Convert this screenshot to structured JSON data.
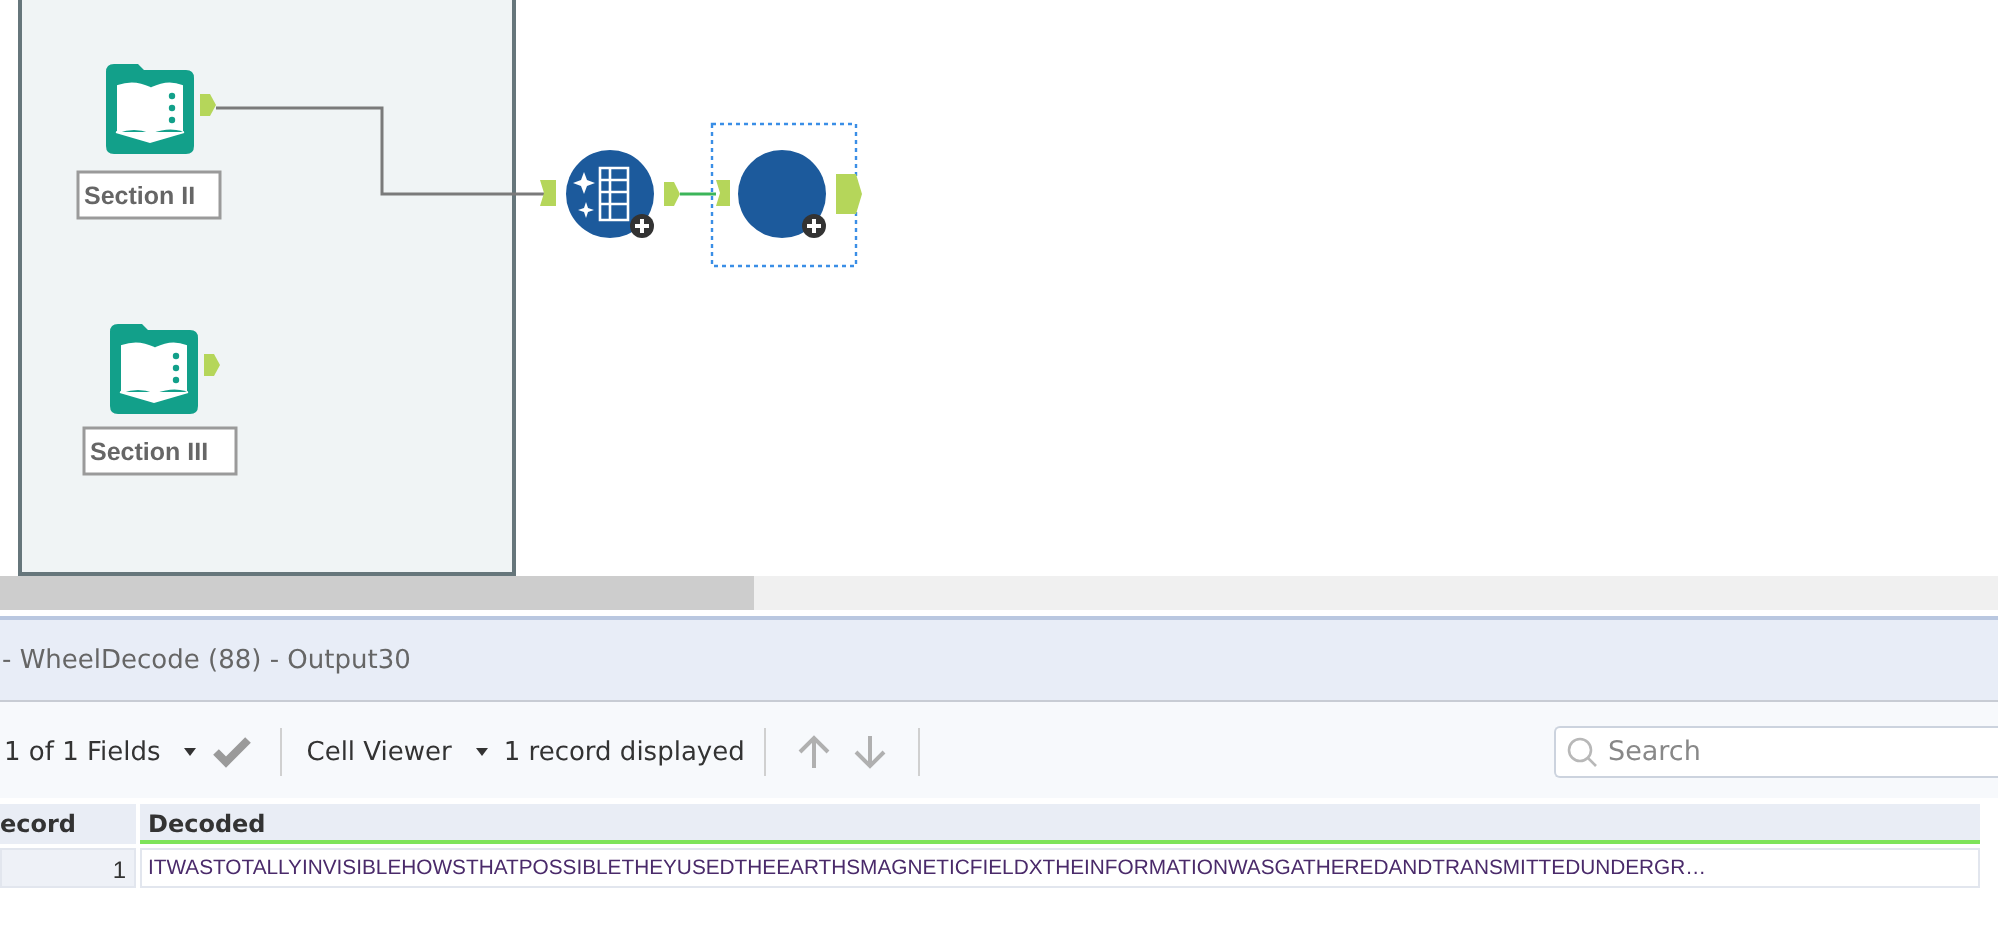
{
  "canvas": {
    "nodes": [
      {
        "kind": "macro-input",
        "label": "Section II",
        "selected": false
      },
      {
        "kind": "macro-input",
        "label": "Section III",
        "selected": false
      },
      {
        "kind": "sparkle-table",
        "selected": false
      },
      {
        "kind": "circle-tool",
        "selected": true
      }
    ]
  },
  "results": {
    "title": "- WheelDecode (88) - Output30",
    "toolbar": {
      "fields_menu": "1 of 1 Fields",
      "viewer_menu": "Cell Viewer",
      "record_count": "1 record displayed",
      "search": {
        "placeholder": "Search"
      }
    },
    "table": {
      "columns": [
        "ecord",
        "Decoded"
      ],
      "rows": [
        [
          "1",
          "ITWASTOTALLYINVISIBLEHOWSTHATPOSSIBLETHEYUSEDTHEEARTHSMAGNETICFIELDXTHEINFORMATIONWASGATHEREDANDTRANSMITTEDUNDERGR…"
        ]
      ]
    }
  }
}
